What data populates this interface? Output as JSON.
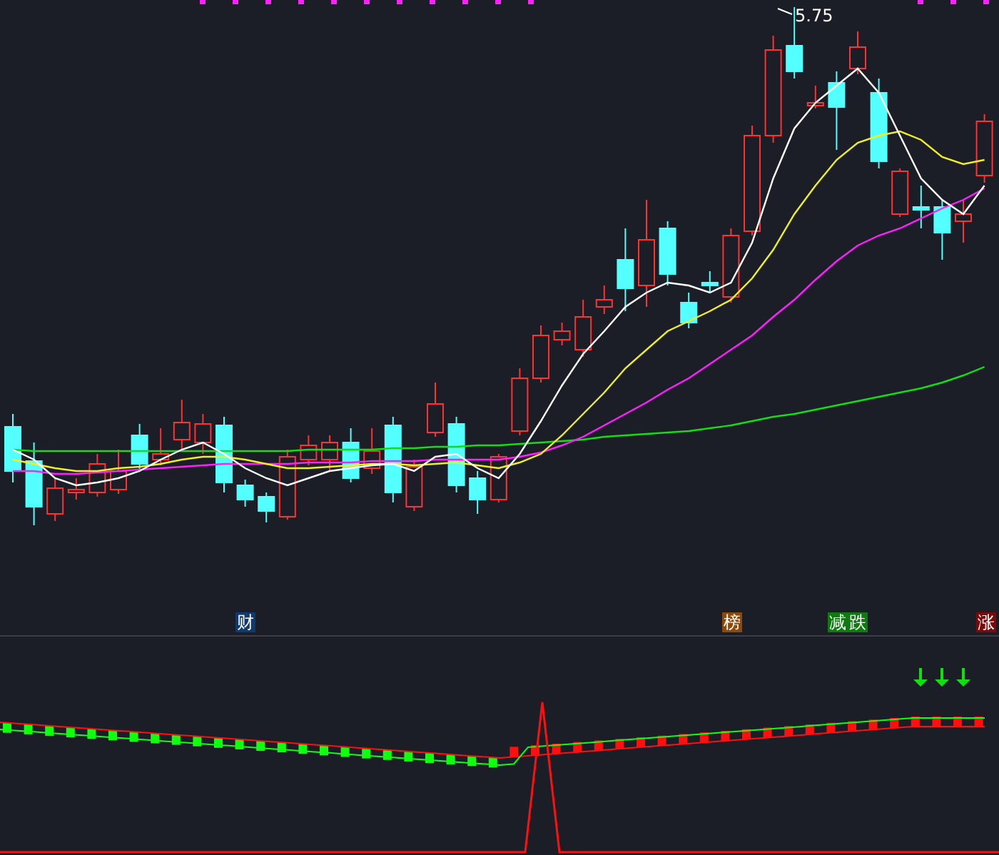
{
  "price_chart": {
    "high_label": "5.75"
  },
  "event_tags": [
    {
      "label": "财",
      "color": "#0f3a6e"
    },
    {
      "label": "榜",
      "color": "#8b4a0c"
    },
    {
      "label": "减",
      "color": "#0f7a0f"
    },
    {
      "label": "跌",
      "color": "#0f7a0f"
    },
    {
      "label": "涨",
      "color": "#7a0a0a"
    }
  ]
}
